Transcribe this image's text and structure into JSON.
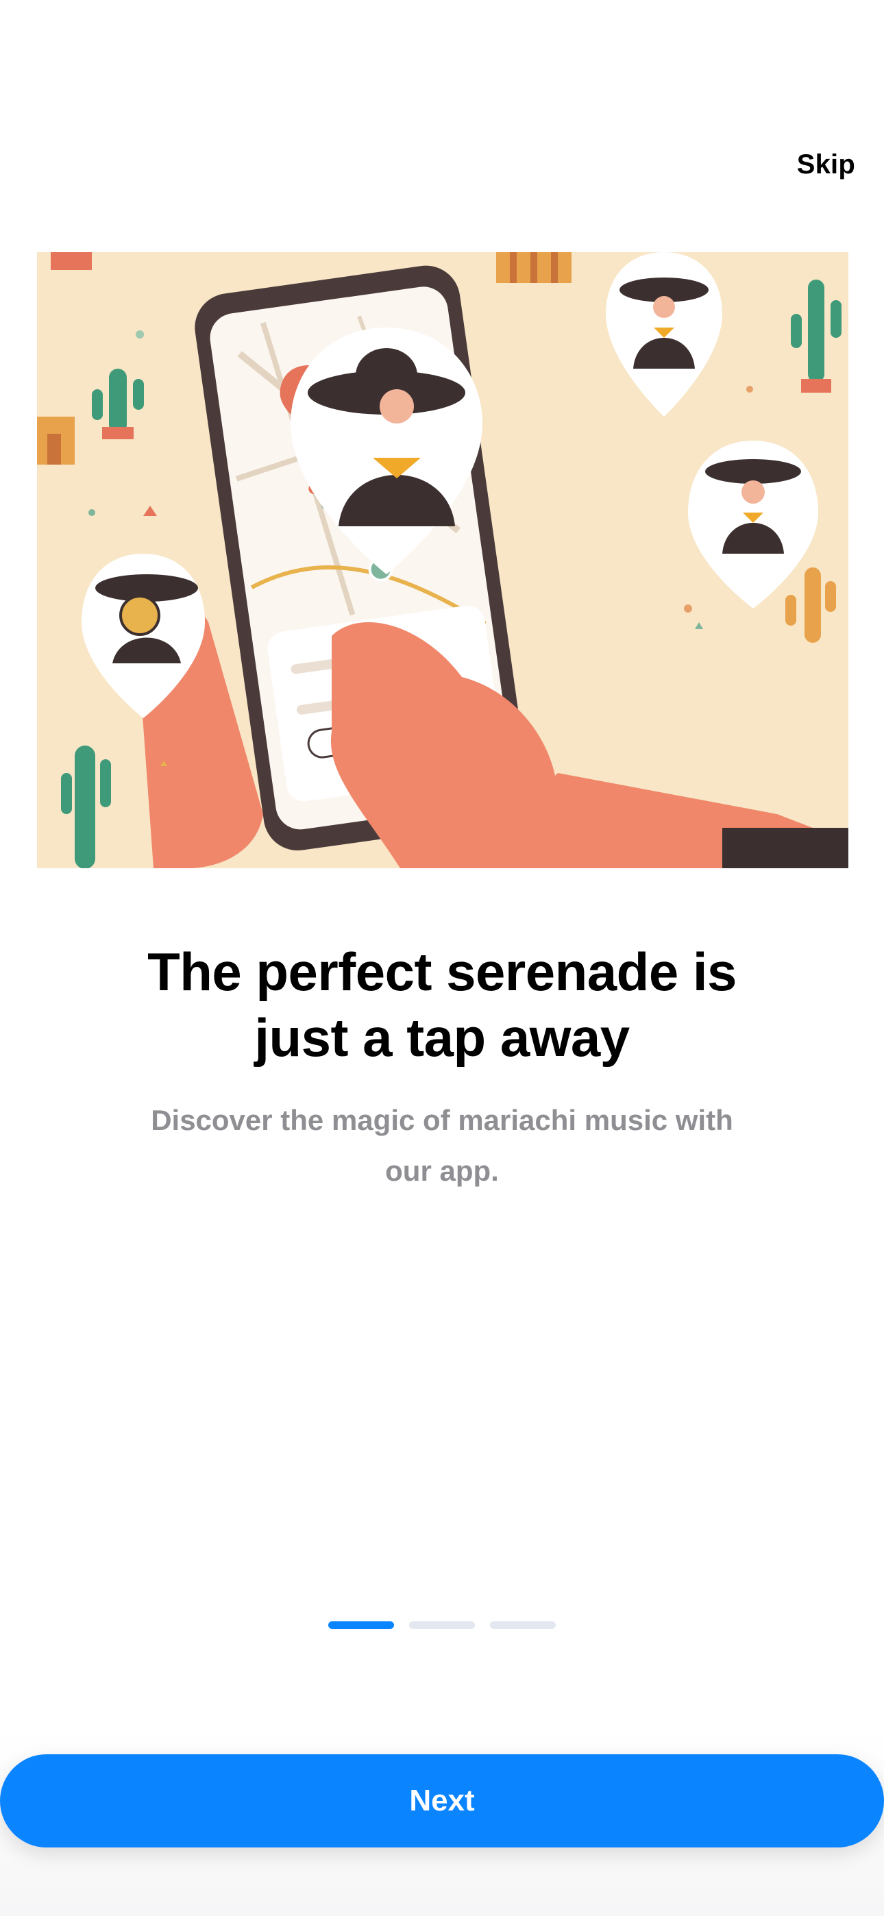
{
  "header": {
    "skip_label": "Skip"
  },
  "hero": {
    "image_subject": "illustration-hands-holding-phone-map-mariachi-pins"
  },
  "onboarding": {
    "title_line1": "The perfect serenade is",
    "title_line2": "just a tap away",
    "subtitle_line1": "Discover the magic of mariachi music with",
    "subtitle_line2": "our app.",
    "current_page": 1,
    "total_pages": 3
  },
  "footer": {
    "next_label": "Next"
  },
  "colors": {
    "accent": "#0a84ff",
    "subtitle": "#8e8e93",
    "indicator_inactive": "#e3e7ef",
    "hero_background": "#f8e6c6"
  }
}
